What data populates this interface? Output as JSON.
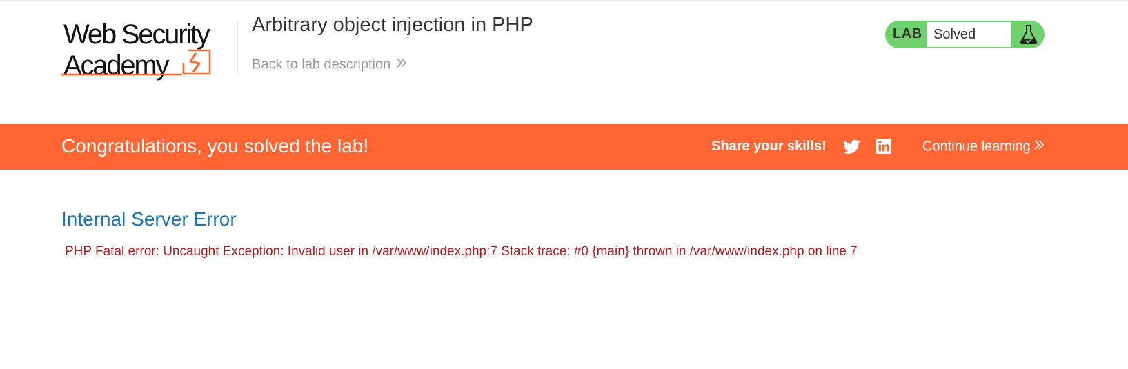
{
  "header": {
    "logo": {
      "line1": "Web Security",
      "line2": "Academy"
    },
    "lab_title": "Arbitrary object injection in PHP",
    "back_link_label": "Back to lab description",
    "status": {
      "tag": "LAB",
      "value": "Solved",
      "icon": "flask-check-icon"
    }
  },
  "banner": {
    "message": "Congratulations, you solved the lab!",
    "share_label": "Share your skills!",
    "share_icons": [
      "twitter-icon",
      "linkedin-icon"
    ],
    "continue_label": "Continue learning"
  },
  "main": {
    "error_heading": "Internal Server Error",
    "error_message": "PHP Fatal error: Uncaught Exception: Invalid user in /var/www/index.php:7 Stack trace: #0 {main} thrown in /var/www/index.php on line 7"
  },
  "colors": {
    "brand_orange": "#ff6633",
    "solved_green": "#70d16d",
    "heading_blue": "#1b78b8",
    "error_red": "#b31b1b"
  }
}
